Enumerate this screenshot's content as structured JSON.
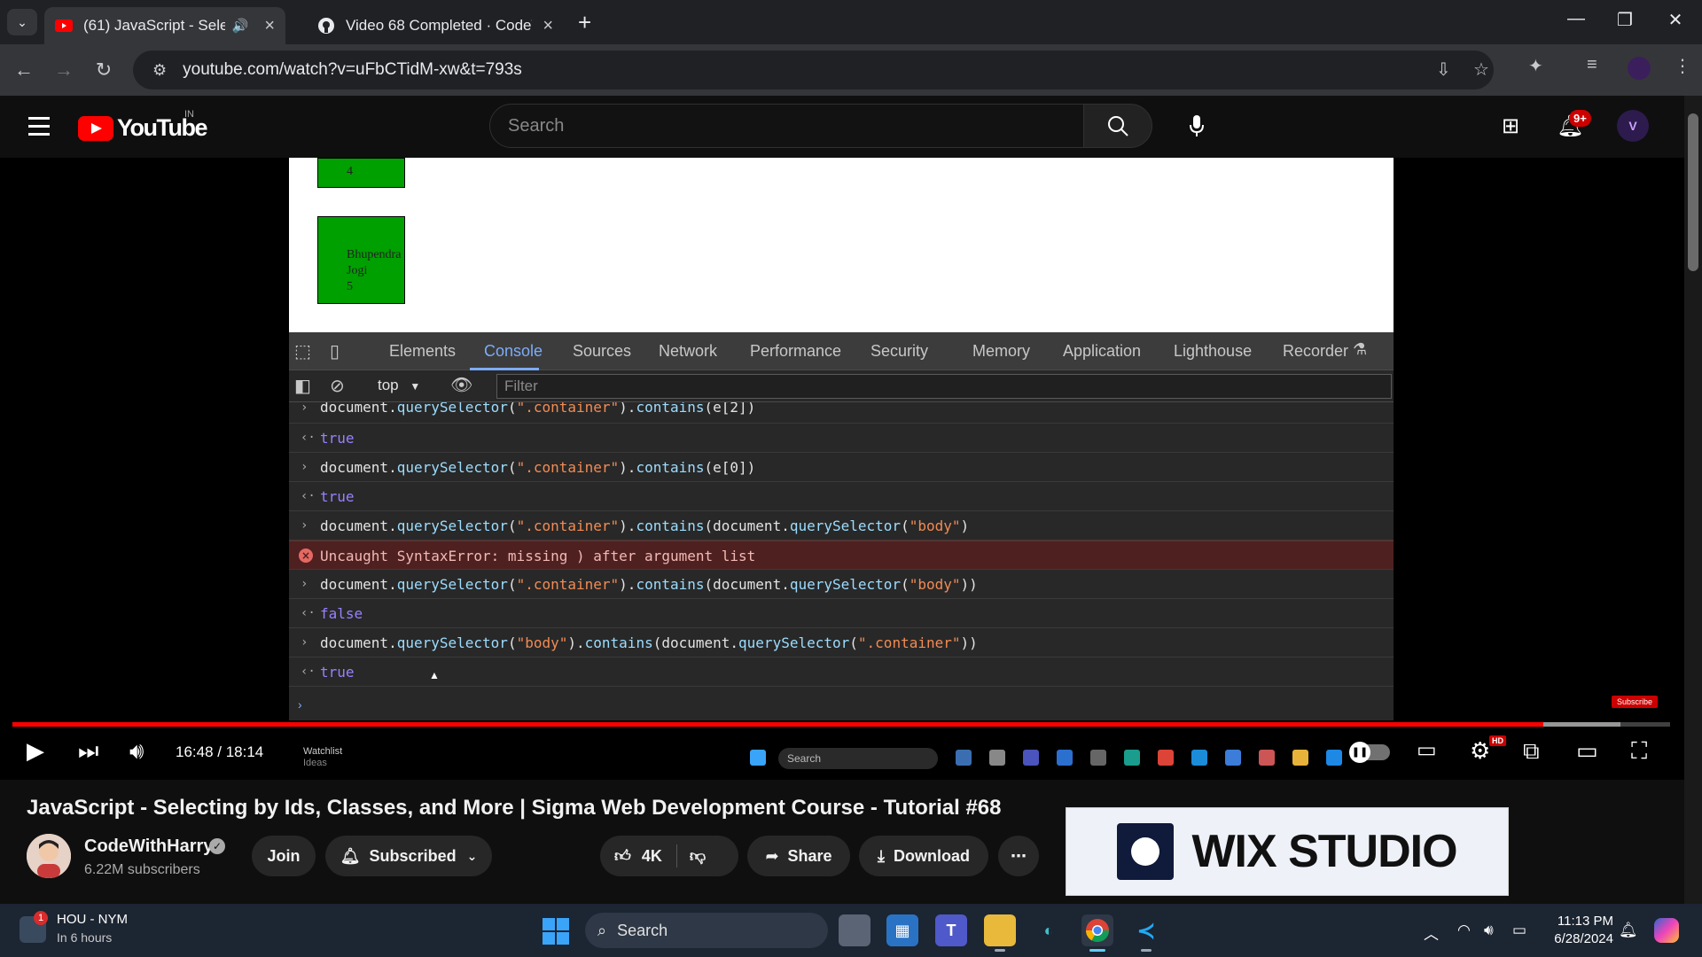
{
  "browser": {
    "tabs": [
      {
        "title": "(61) JavaScript - Selecting b",
        "active": true
      },
      {
        "title": "Video 68 Completed · CodeWit",
        "active": false
      }
    ],
    "url": "youtube.com/watch?v=uFbCTidM-xw&t=793s"
  },
  "youtube": {
    "logo_text": "YouTube",
    "country": "IN",
    "search_placeholder": "Search",
    "notifications_badge": "9+"
  },
  "page_preview": {
    "box_top_label": "4",
    "box_bottom_lines": [
      "Bhupendra",
      "Jogi",
      "5"
    ]
  },
  "devtools": {
    "tabs": [
      "Elements",
      "Console",
      "Sources",
      "Network",
      "Performance",
      "Security",
      "Memory",
      "Application",
      "Lighthouse",
      "Recorder"
    ],
    "active_tab": "Console",
    "context": "top",
    "filter_placeholder": "Filter",
    "console": [
      {
        "kind": "input",
        "text": "document.querySelector(\".container\").contains(e[2])"
      },
      {
        "kind": "output",
        "text": "true"
      },
      {
        "kind": "input",
        "text": "document.querySelector(\".container\").contains(e[0])"
      },
      {
        "kind": "output",
        "text": "true"
      },
      {
        "kind": "input",
        "text": "document.querySelector(\".container\").contains(document.querySelector(\"body\")"
      },
      {
        "kind": "error",
        "text": "Uncaught SyntaxError: missing ) after argument list"
      },
      {
        "kind": "input",
        "text": "document.querySelector(\".container\").contains(document.querySelector(\"body\"))"
      },
      {
        "kind": "output",
        "text": "false"
      },
      {
        "kind": "input",
        "text": "document.querySelector(\"body\").contains(document.querySelector(\".container\"))"
      },
      {
        "kind": "output",
        "text": "true"
      }
    ]
  },
  "player": {
    "time": "16:48 / 18:14",
    "progress": 0.9237,
    "buffered": 0.97,
    "hd_label": "HD",
    "watermark": "Subscribe",
    "inner_taskbar": {
      "watchlist": "Watchlist",
      "ideas": "Ideas",
      "search": "Search"
    }
  },
  "video": {
    "title": "JavaScript - Selecting by Ids, Classes, and More | Sigma Web Development Course - Tutorial #68",
    "channel": "CodeWithHarry",
    "subscribers": "6.22M subscribers",
    "join_label": "Join",
    "subscribed_label": "Subscribed",
    "likes": "4K",
    "share_label": "Share",
    "download_label": "Download"
  },
  "ad": {
    "text": "WIX STUDIO"
  },
  "taskbar": {
    "weather_title": "HOU - NYM",
    "weather_sub": "In 6 hours",
    "weather_badge": "1",
    "search_label": "Search",
    "time": "11:13 PM",
    "date": "6/28/2024"
  },
  "colors": {
    "accent": "#ff0000",
    "devtools_active": "#7cacf8",
    "error_bg": "#4e2020"
  }
}
